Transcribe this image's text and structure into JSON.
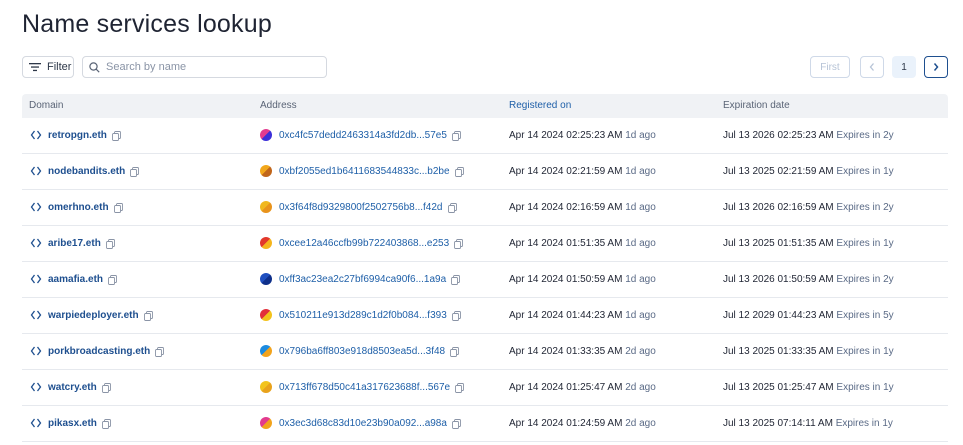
{
  "page": {
    "title": "Name services lookup"
  },
  "toolbar": {
    "filter_label": "Filter",
    "search_placeholder": "Search by name",
    "search_value": ""
  },
  "pagination": {
    "first_label": "First",
    "current_page": "1"
  },
  "table": {
    "headers": {
      "domain": "Domain",
      "address": "Address",
      "registered": "Registered on",
      "expiration": "Expiration date"
    },
    "rows": [
      {
        "domain": "retropgn.eth",
        "address": "0xc4fc57dedd2463314a3fd2db...57e5",
        "registered": "Apr 14 2024 02:25:23 AM",
        "registered_ago": "1d ago",
        "expiration": "Jul 13 2026 02:25:23 AM",
        "expires_in": "Expires in 2y",
        "avatar_colors": [
          "#e23b8e",
          "#3b2fd9"
        ]
      },
      {
        "domain": "nodebandits.eth",
        "address": "0xbf2055ed1b6411683544833c...b2be",
        "registered": "Apr 14 2024 02:21:59 AM",
        "registered_ago": "1d ago",
        "expiration": "Jul 13 2025 02:21:59 AM",
        "expires_in": "Expires in 1y",
        "avatar_colors": [
          "#f2a71b",
          "#c0651a"
        ]
      },
      {
        "domain": "omerhno.eth",
        "address": "0x3f64f8d9329800f2502756b8...f42d",
        "registered": "Apr 14 2024 02:16:59 AM",
        "registered_ago": "1d ago",
        "expiration": "Jul 13 2026 02:16:59 AM",
        "expires_in": "Expires in 2y",
        "avatar_colors": [
          "#f0b81e",
          "#e8931c"
        ]
      },
      {
        "domain": "aribe17.eth",
        "address": "0xcee12a46ccfb99b722403868...e253",
        "registered": "Apr 14 2024 01:51:35 AM",
        "registered_ago": "1d ago",
        "expiration": "Jul 13 2025 01:51:35 AM",
        "expires_in": "Expires in 1y",
        "avatar_colors": [
          "#e2382b",
          "#f5b51c"
        ]
      },
      {
        "domain": "aamafia.eth",
        "address": "0xff3ac23ea2c27bf6994ca90f6...1a9a",
        "registered": "Apr 14 2024 01:50:59 AM",
        "registered_ago": "1d ago",
        "expiration": "Jul 13 2026 01:50:59 AM",
        "expires_in": "Expires in 2y",
        "avatar_colors": [
          "#1f4fbf",
          "#0e2f8a"
        ]
      },
      {
        "domain": "warpiedeployer.eth",
        "address": "0x510211e913d289c1d2f0b084...f393",
        "registered": "Apr 14 2024 01:44:23 AM",
        "registered_ago": "1d ago",
        "expiration": "Jul 12 2029 01:44:23 AM",
        "expires_in": "Expires in 5y",
        "avatar_colors": [
          "#e22f3b",
          "#f2c21c"
        ]
      },
      {
        "domain": "porkbroadcasting.eth",
        "address": "0x796ba6ff803e918d8503ea5d...3f48",
        "registered": "Apr 14 2024 01:33:35 AM",
        "registered_ago": "2d ago",
        "expiration": "Jul 13 2025 01:33:35 AM",
        "expires_in": "Expires in 1y",
        "avatar_colors": [
          "#1c8be0",
          "#f2a31c"
        ]
      },
      {
        "domain": "watcry.eth",
        "address": "0x713ff678d50c41a317623688f...567e",
        "registered": "Apr 14 2024 01:25:47 AM",
        "registered_ago": "2d ago",
        "expiration": "Jul 13 2025 01:25:47 AM",
        "expires_in": "Expires in 1y",
        "avatar_colors": [
          "#f2c41c",
          "#e8a21c"
        ]
      },
      {
        "domain": "pikasx.eth",
        "address": "0x3ec3d68c83d10e23b90a092...a98a",
        "registered": "Apr 14 2024 01:24:59 AM",
        "registered_ago": "2d ago",
        "expiration": "Jul 13 2025 07:14:11 AM",
        "expires_in": "Expires in 1y",
        "avatar_colors": [
          "#e23b8e",
          "#f2a31c"
        ]
      }
    ]
  },
  "icons": {
    "filter": "filter-lines-icon",
    "search": "search-icon",
    "domain": "code-brackets-icon",
    "copy": "copy-icon",
    "prev": "chevron-left-icon",
    "next": "chevron-right-icon"
  },
  "colors": {
    "link": "#1e4f8f",
    "accent": "#1e5fa8",
    "header_bg": "#f0f2f5"
  }
}
